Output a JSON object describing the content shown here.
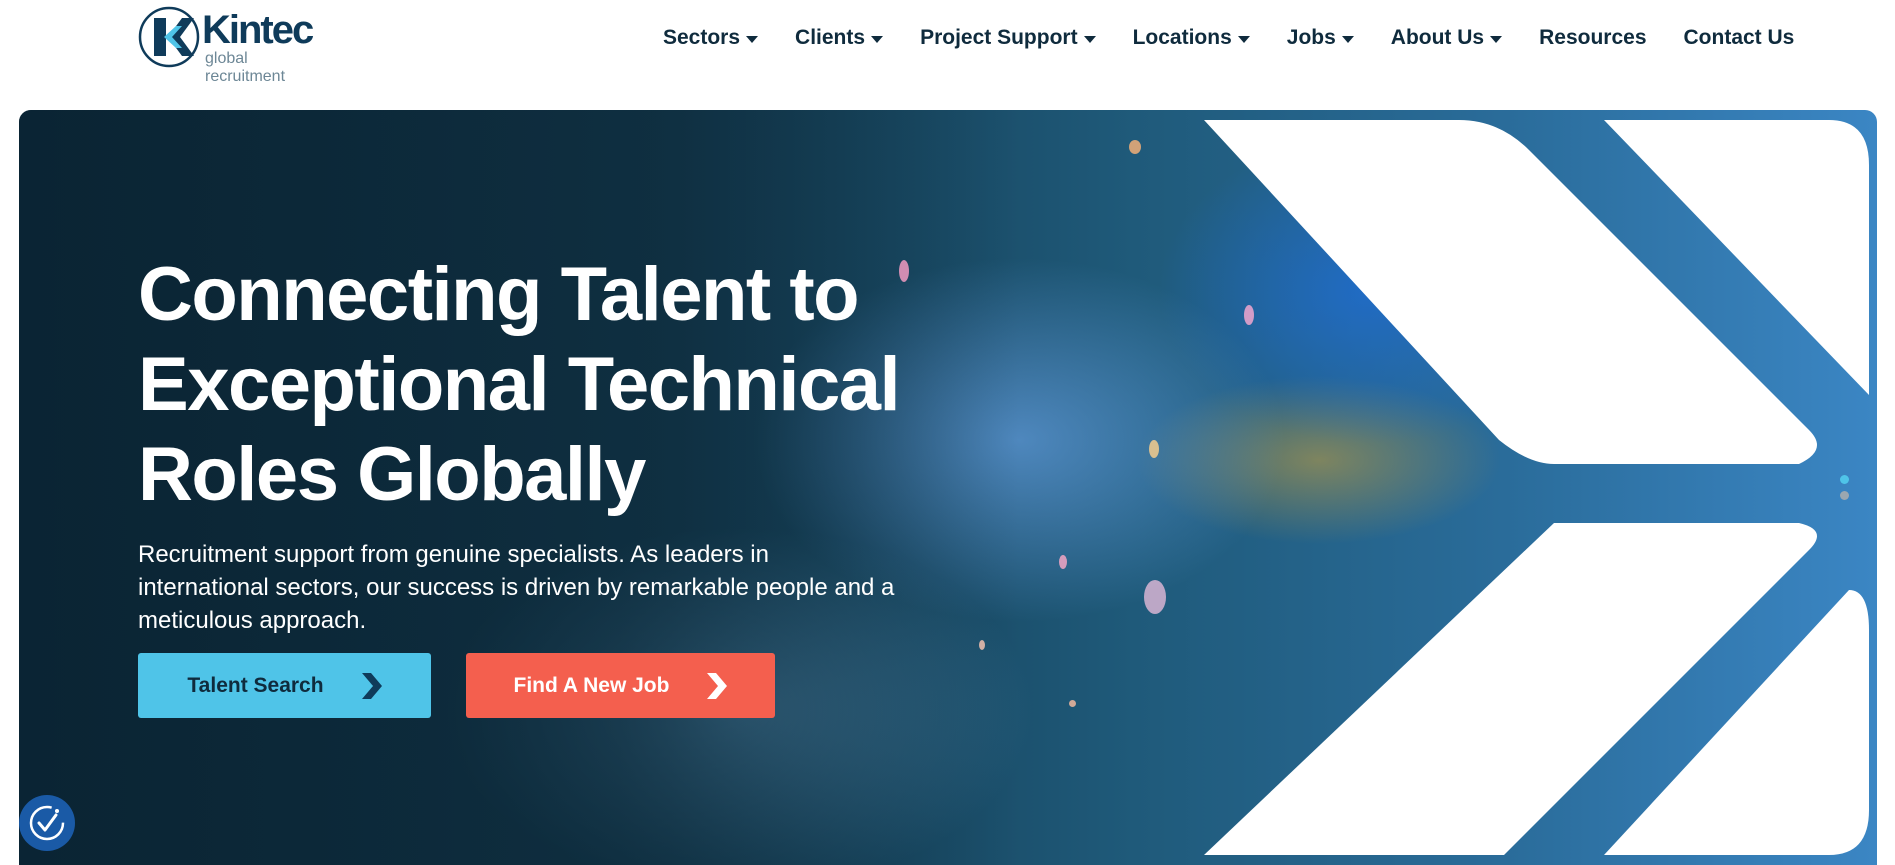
{
  "brand": {
    "name": "Kintec",
    "tagline": "global recruitment",
    "colors": {
      "primary": "#0f3b5a",
      "accent_blue": "#4fc4e8",
      "accent_red": "#f45f4e"
    }
  },
  "nav": {
    "items": [
      {
        "label": "Sectors",
        "has_dropdown": true
      },
      {
        "label": "Clients",
        "has_dropdown": true
      },
      {
        "label": "Project Support",
        "has_dropdown": true
      },
      {
        "label": "Locations",
        "has_dropdown": true
      },
      {
        "label": "Jobs",
        "has_dropdown": true
      },
      {
        "label": "About Us",
        "has_dropdown": true
      },
      {
        "label": "Resources",
        "has_dropdown": false
      },
      {
        "label": "Contact Us",
        "has_dropdown": false
      }
    ]
  },
  "hero": {
    "title_line_1": "Connecting Talent to",
    "title_line_2": "Exceptional Technical",
    "title_line_3": "Roles Globally",
    "subtitle": "Recruitment support from genuine specialists. As leaders in international sectors, our success is driven by remarkable people and a meticulous approach.",
    "buttons": {
      "talent_search": "Talent Search",
      "find_job": "Find A New Job"
    },
    "slider": {
      "slide_count": 2,
      "active_index": 0
    }
  },
  "icons": {
    "nav_caret": "caret-down-icon",
    "button_arrow": "chevron-right-icon",
    "accessibility": "accessibility-icon"
  }
}
